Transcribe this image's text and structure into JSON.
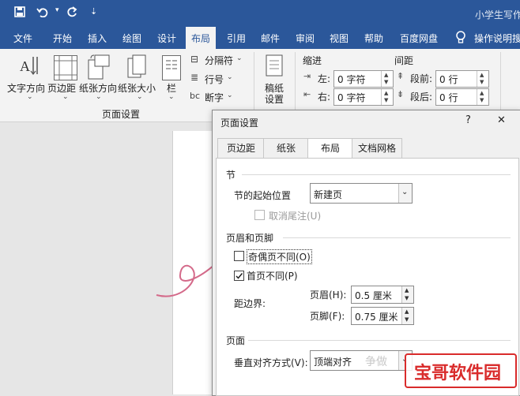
{
  "app": {
    "title_text": "小学生写作",
    "quick_access": {
      "save_icon": "save-icon",
      "undo_icon": "undo-icon",
      "redo_icon": "redo-icon",
      "customize": "⇣"
    }
  },
  "menu": {
    "items": [
      "文件",
      "开始",
      "插入",
      "绘图",
      "设计",
      "布局",
      "引用",
      "邮件",
      "审阅",
      "视图",
      "帮助",
      "百度网盘"
    ],
    "active": "布局",
    "tell_me": "操作说明搜"
  },
  "ribbon": {
    "page_setup_group": "页面设置",
    "buttons": {
      "text_direction": "文字方向",
      "margins": "页边距",
      "orientation": "纸张方向",
      "size": "纸张大小",
      "columns": "栏",
      "breaks": "分隔符",
      "line_numbers": "行号",
      "hyphenation": "断字",
      "manuscript": "稿纸",
      "manuscript_settings": "设置"
    },
    "indent": {
      "header": "缩进",
      "left_label": "左:",
      "left_value": "0 字符",
      "right_label": "右:",
      "right_value": "0 字符"
    },
    "spacing": {
      "header": "间距",
      "before_label": "段前:",
      "before_value": "0 行",
      "after_label": "段后:",
      "after_value": "0 行"
    }
  },
  "dialog": {
    "title": "页面设置",
    "help": "?",
    "close": "✕",
    "tabs": [
      "页边距",
      "纸张",
      "布局",
      "文档网格"
    ],
    "active_tab": "布局",
    "section": {
      "title": "节",
      "start_label": "节的起始位置",
      "start_value": "新建页",
      "suppress_endnotes": "取消尾注(U)"
    },
    "headers_footers": {
      "title": "页眉和页脚",
      "odd_even": "奇偶页不同(O)",
      "odd_even_checked": false,
      "first_page": "首页不同(P)",
      "first_page_checked": true,
      "from_edge": "距边界:",
      "header_label": "页眉(H):",
      "header_value": "0.5 厘米",
      "footer_label": "页脚(F):",
      "footer_value": "0.75 厘米"
    },
    "page": {
      "title": "页面",
      "vertical_label": "垂直对齐方式(V):",
      "vertical_value": "顶端对齐"
    }
  },
  "watermark": {
    "small_text": "争做",
    "site_text": "宝哥软件园",
    "site_color": "#d92b2b"
  },
  "annotation": {
    "color": "#d46a8a"
  }
}
